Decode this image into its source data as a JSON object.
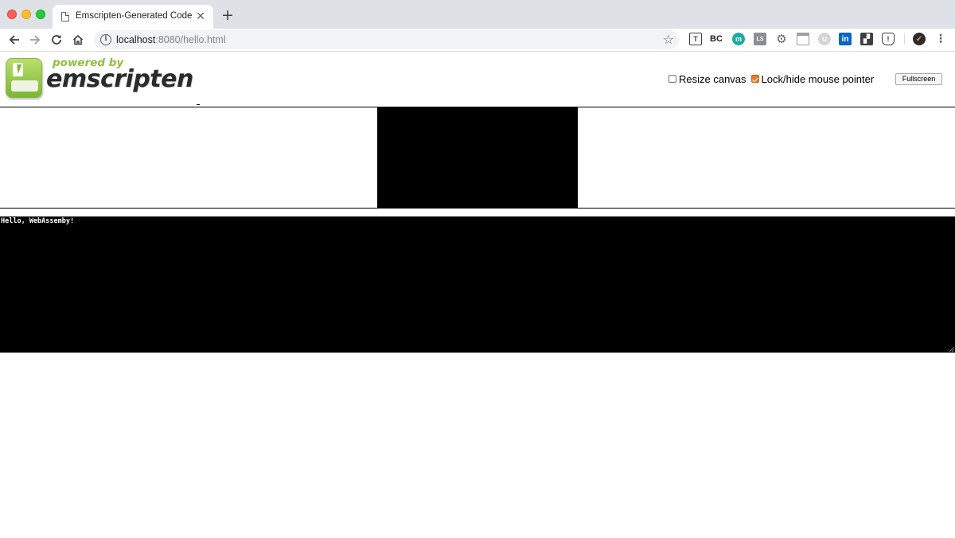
{
  "browser": {
    "tab_title": "Emscripten-Generated Code",
    "tab_close": "✕",
    "new_tab": "+",
    "url_host": "localhost",
    "url_path": ":8080/hello.html"
  },
  "extensions": [
    {
      "name": "tampermonkey-icon",
      "glyph": "T"
    },
    {
      "name": "bc-extension-icon",
      "glyph": "BC"
    },
    {
      "name": "m-extension-icon",
      "glyph": "m"
    },
    {
      "name": "ls-extension-icon",
      "glyph": "LS"
    },
    {
      "name": "gear-extension-icon",
      "glyph": "⚙"
    },
    {
      "name": "window-extension-icon",
      "glyph": ""
    },
    {
      "name": "circle-extension-icon",
      "glyph": "U"
    },
    {
      "name": "linkedin-icon",
      "glyph": "in"
    },
    {
      "name": "image-extension-icon",
      "glyph": "▞"
    },
    {
      "name": "shield-extension-icon",
      "glyph": "!"
    },
    {
      "name": "profile-avatar-icon",
      "glyph": "✓"
    },
    {
      "name": "menu-icon",
      "glyph": "⋮"
    }
  ],
  "header": {
    "logo_powered_by": "powered by",
    "logo_wordmark": "emscripten",
    "resize_canvas_label": "Resize canvas",
    "resize_canvas_checked": false,
    "lock_pointer_label": "Lock/hide mouse pointer",
    "lock_pointer_checked": true,
    "fullscreen_label": "Fullscreen"
  },
  "output": {
    "text": "Hello, WebAssemby!"
  }
}
